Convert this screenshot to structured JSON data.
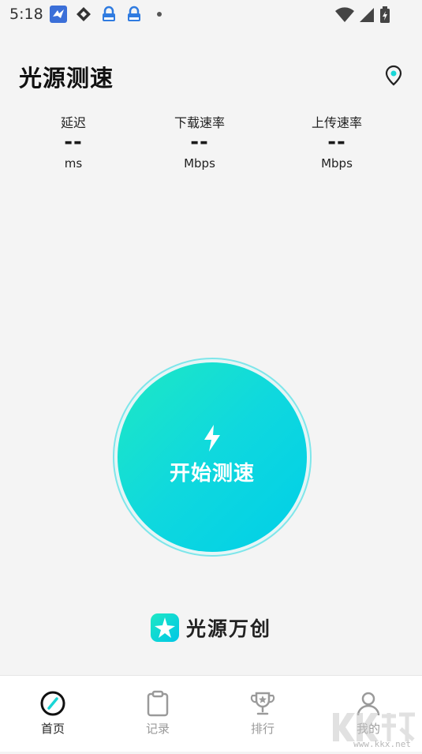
{
  "status_bar": {
    "time": "5:18",
    "notification_icons": [
      "sparrow-icon",
      "diamond-icon",
      "lock-badge-icon",
      "lock-badge-icon",
      "more-dot-icon"
    ],
    "right_icons": [
      "wifi-icon",
      "signal-icon",
      "battery-icon"
    ]
  },
  "header": {
    "title": "光源测速",
    "location_icon": "location-pin-icon"
  },
  "metrics": [
    {
      "label": "延迟",
      "value": "--",
      "unit": "ms"
    },
    {
      "label": "下载速率",
      "value": "--",
      "unit": "Mbps"
    },
    {
      "label": "上传速率",
      "value": "--",
      "unit": "Mbps"
    }
  ],
  "start": {
    "label": "开始测速",
    "icon": "bolt-icon"
  },
  "brand": {
    "name": "光源万创"
  },
  "nav": {
    "items": [
      {
        "label": "首页",
        "icon": "speedometer-icon",
        "active": true
      },
      {
        "label": "记录",
        "icon": "clipboard-icon",
        "active": false
      },
      {
        "label": "排行",
        "icon": "trophy-icon",
        "active": false
      },
      {
        "label": "我的",
        "icon": "user-icon",
        "active": false
      }
    ]
  },
  "watermark": {
    "text": "www.kkx.net"
  },
  "colors": {
    "accent_start": "#1ee8c4",
    "accent_end": "#00cfe8",
    "background": "#f4f4f4"
  }
}
